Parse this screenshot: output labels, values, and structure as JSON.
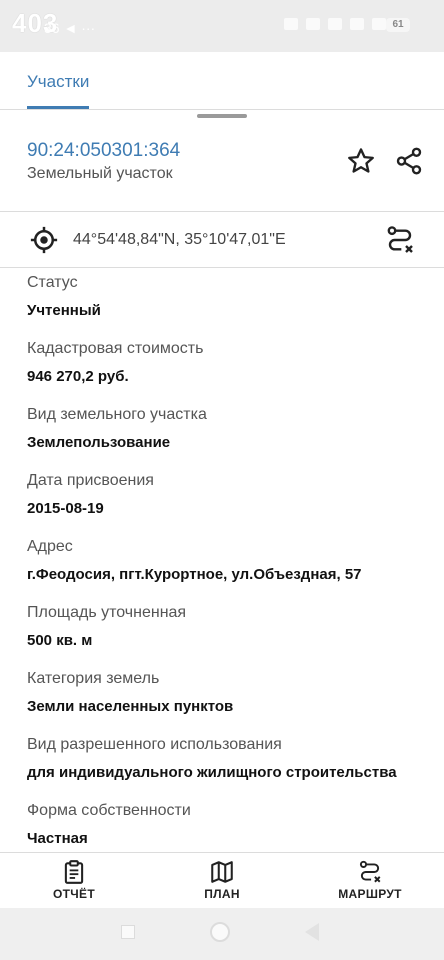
{
  "status_bar": {
    "time": "403",
    "sub": "36 ◄ ···",
    "battery": "61"
  },
  "tabs": [
    {
      "label": "Участки",
      "active": true
    }
  ],
  "parcel": {
    "cadastral_number": "90:24:050301:364",
    "type": "Земельный участок",
    "coordinates": "44°54'48,84\"N, 35°10'47,01\"E"
  },
  "fields": [
    {
      "label": "Статус",
      "value": "Учтенный"
    },
    {
      "label": "Кадастровая стоимость",
      "value": "946 270,2 руб."
    },
    {
      "label": "Вид земельного участка",
      "value": "Землепользование"
    },
    {
      "label": "Дата присвоения",
      "value": "2015-08-19"
    },
    {
      "label": "Адрес",
      "value": "г.Феодосия, пгт.Курортное, ул.Объездная, 57"
    },
    {
      "label": "Площадь уточненная",
      "value": "500 кв. м"
    },
    {
      "label": "Категория земель",
      "value": "Земли населенных пунктов"
    },
    {
      "label": "Вид разрешенного использования",
      "value": "для индивидуального жилищного строительства"
    },
    {
      "label": "Форма собственности",
      "value": "Частная"
    }
  ],
  "toolbar": {
    "report_label": "ОТЧЁТ",
    "plan_label": "ПЛАН",
    "route_label": "МАРШРУТ"
  },
  "colors": {
    "accent": "#3f7cb3",
    "divider": "#dcdcdc"
  },
  "icons": [
    "star-icon",
    "share-icon",
    "target-icon",
    "route-icon",
    "report-icon",
    "map-icon"
  ]
}
